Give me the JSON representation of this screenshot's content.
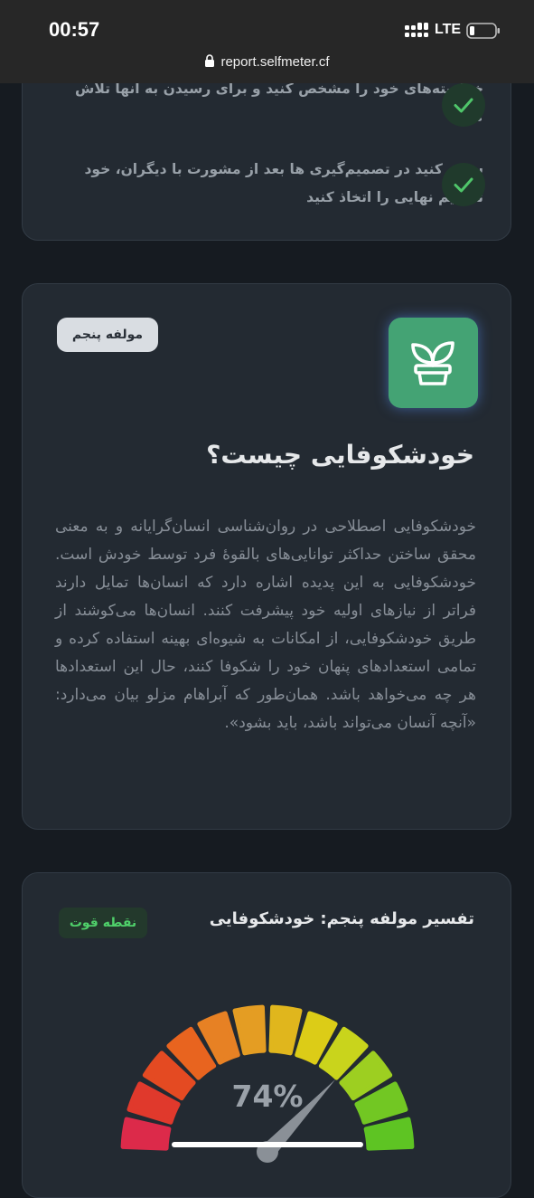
{
  "status_bar": {
    "time": "00:57",
    "network": "LTE",
    "url": "report.selfmeter.cf"
  },
  "card1": {
    "tips": [
      "خواسته‌های خود را مشخص کنید و برای رسیدن به آنها تلاش کنید",
      "سعی کنید در تصمیم‌گیری ها بعد از مشورت با دیگران، خود تصمیم نهایی را اتخاذ کنید"
    ]
  },
  "card2": {
    "badge": "مولفه پنجم",
    "icon": "plant-icon",
    "title": "خودشکوفایی چیست؟",
    "paragraph": "خودشکوفایی اصطلاحی در روان‌شناسی انسان‌گرایانه و به معنی محقق ساختن حداکثر توانایی‌های بالقوهٔ فرد توسط خودش است. خودشکوفایی به این پدیده اشاره دارد که انسان‌ها تمایل دارند فراتر از نیازهای اولیه خود پیشرفت کنند. انسان‌ها می‌کوشند از طریق خودشکوفایی، از امکانات به شیوه‌ای بهینه استفاده کرده و تمامی استعدادهای پنهان خود را شکوفا کنند، حال این استعدادها هر چه می‌خواهد باشد. همان‌طور که آبراهام مزلو بیان می‌دارد: «آنچه آنسان می‌تواند باشد، باید بشود»."
  },
  "card3": {
    "title": "تفسیر مولفه پنجم: خودشکوفایی",
    "badge": "نقطه قوت",
    "gauge": {
      "value_label": "74%",
      "value": 74,
      "segment_colors": [
        "#dc2a4a",
        "#e0392c",
        "#e44a22",
        "#e8641f",
        "#e78124",
        "#e49d23",
        "#e0b61d",
        "#dccc17",
        "#c9d41c",
        "#9dcf21",
        "#72c723",
        "#5ec423"
      ]
    }
  },
  "colors": {
    "accent_green": "#44a374",
    "background": "#161b21",
    "card": "#232a32"
  }
}
